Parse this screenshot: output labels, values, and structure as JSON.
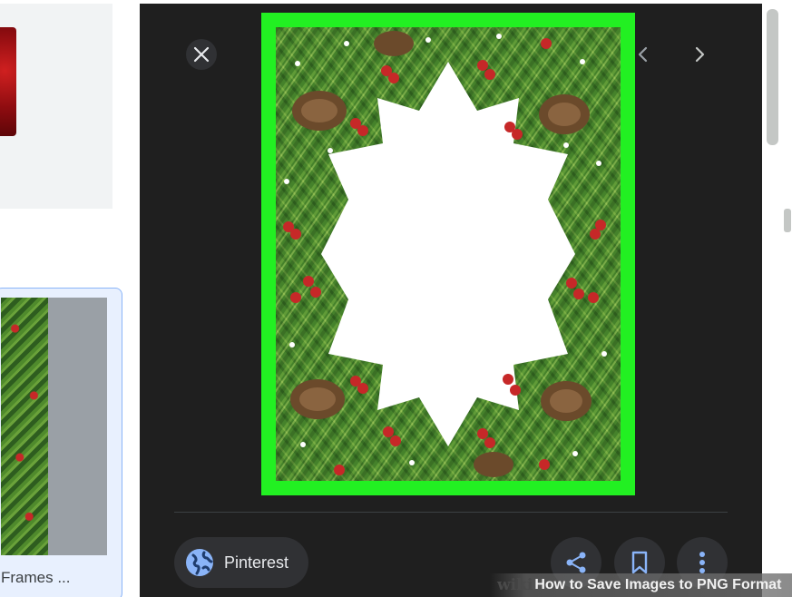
{
  "left_panel": {
    "result_caption": "Frames ..."
  },
  "preview": {
    "close_icon": "close-icon",
    "prev_icon": "chevron-left-icon",
    "next_icon": "chevron-right-icon",
    "source": {
      "label": "Pinterest",
      "icon": "globe-icon"
    },
    "actions": {
      "share_icon": "share-icon",
      "save_icon": "bookmark-icon",
      "more_icon": "more-vert-icon"
    },
    "highlight_color": "#22f022"
  },
  "watermark": {
    "brand": "wiki",
    "title": "How to Save Images to PNG Format"
  },
  "colors": {
    "panel_bg": "#1f1f1f",
    "chip_bg": "#303134",
    "globe_blue": "#8ab4f8"
  }
}
